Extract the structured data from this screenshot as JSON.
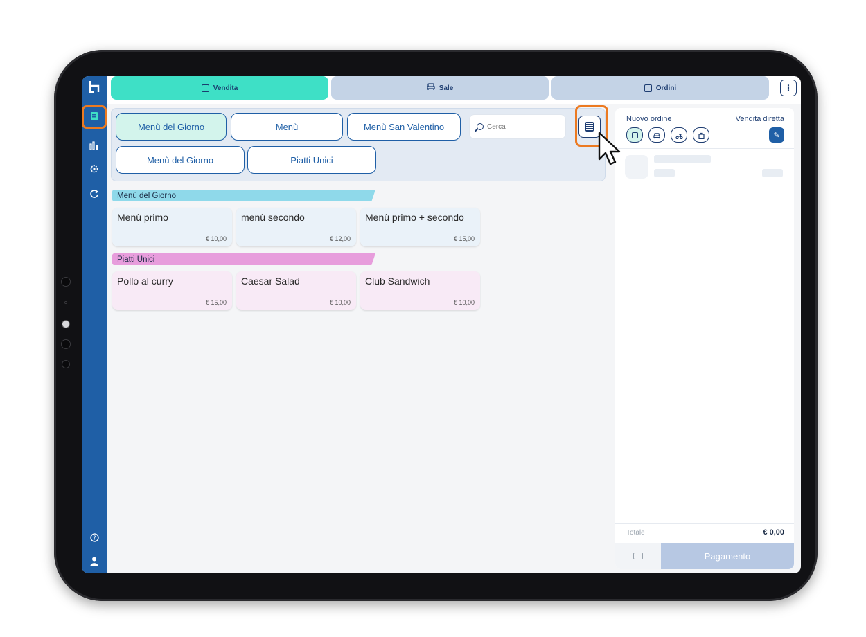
{
  "tabs": [
    {
      "label": "Vendita",
      "icon": "menu-book-icon",
      "active": true
    },
    {
      "label": "Sale",
      "icon": "armchair-icon",
      "active": false
    },
    {
      "label": "Ordini",
      "icon": "receipt-icon",
      "active": false
    }
  ],
  "rail_icons": [
    "logo-icon",
    "menu-book-icon",
    "bar-chart-icon",
    "settings-icon",
    "refresh-icon",
    "help-icon",
    "user-icon"
  ],
  "categories": {
    "row1": [
      "Menù del Giorno",
      "Menù",
      "Menù San Valentino"
    ],
    "row2": [
      "Menù del Giorno",
      "Piatti Unici"
    ],
    "active_index": 0
  },
  "search": {
    "placeholder": "Cerca"
  },
  "sections": [
    {
      "title": "Menù del Giorno",
      "color": "#8fd9ea",
      "card_color": "#eaf2f9",
      "items": [
        {
          "name": "Menù primo",
          "price": "€ 10,00"
        },
        {
          "name": "menù secondo",
          "price": "€ 12,00"
        },
        {
          "name": "Menù primo + secondo",
          "price": "€ 15,00"
        }
      ]
    },
    {
      "title": "Piatti Unici",
      "color": "#e79ddc",
      "card_color": "#f8eaf6",
      "items": [
        {
          "name": "Pollo al curry",
          "price": "€ 15,00"
        },
        {
          "name": "Caesar Salad",
          "price": "€ 10,00"
        },
        {
          "name": "Club Sandwich",
          "price": "€ 10,00"
        }
      ]
    }
  ],
  "order": {
    "title": "Nuovo ordine",
    "mode": "Vendita diretta",
    "order_types": [
      "menu-book-icon",
      "armchair-icon",
      "delivery-icon",
      "takeaway-bag-icon"
    ],
    "total_label": "Totale",
    "total_value": "€ 0,00",
    "pay_label": "Pagamento"
  },
  "colors": {
    "rail": "#1f5fa6",
    "tab_active": "#3ee0c6",
    "tab_inactive": "#c4d3e6",
    "highlight": "#ec7a21",
    "pay_button": "#b7c8e3"
  }
}
